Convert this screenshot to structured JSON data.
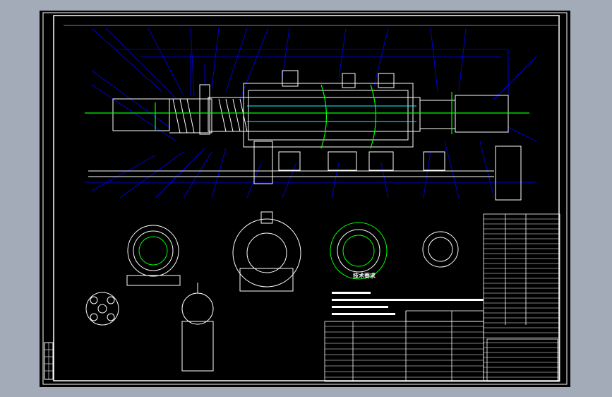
{
  "drawing": {
    "tech_requirements_title": "技术要求",
    "colors": {
      "background": "#000000",
      "frame": "#ffffff",
      "outline": "#ffffff",
      "leader": "#0000ff",
      "centerline": "#00ff00",
      "window": "#a3abb8"
    }
  }
}
